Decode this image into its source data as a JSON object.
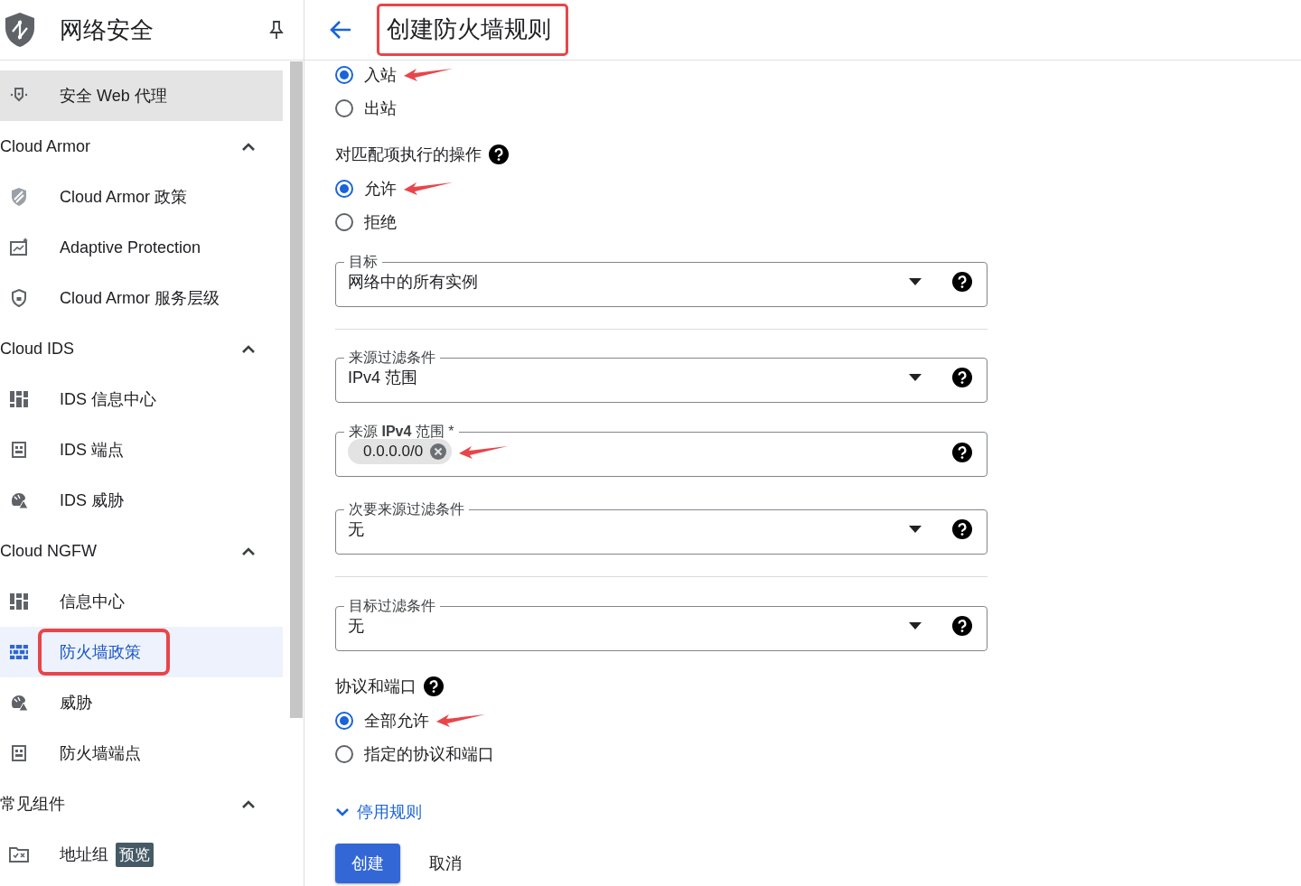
{
  "app": {
    "title": "网络安全"
  },
  "sidebar": {
    "items": [
      {
        "label": "安全 Web 代理",
        "selected": false,
        "hovered": true
      }
    ],
    "sections": [
      {
        "title": "Cloud Armor",
        "expanded": true,
        "items": [
          {
            "label": "Cloud Armor 政策",
            "selected": false,
            "annotated": false
          },
          {
            "label": "Adaptive Protection",
            "selected": false,
            "annotated": false
          },
          {
            "label": "Cloud Armor 服务层级",
            "selected": false,
            "annotated": false
          }
        ]
      },
      {
        "title": "Cloud IDS",
        "expanded": true,
        "items": [
          {
            "label": "IDS 信息中心",
            "selected": false,
            "annotated": false
          },
          {
            "label": "IDS 端点",
            "selected": false,
            "annotated": false
          },
          {
            "label": "IDS 威胁",
            "selected": false,
            "annotated": false
          }
        ]
      },
      {
        "title": "Cloud NGFW",
        "expanded": true,
        "items": [
          {
            "label": "信息中心",
            "selected": false,
            "annotated": false
          },
          {
            "label": "防火墙政策",
            "selected": true,
            "annotated": true
          },
          {
            "label": "威胁",
            "selected": false,
            "annotated": false
          },
          {
            "label": "防火墙端点",
            "selected": false,
            "annotated": false
          }
        ]
      },
      {
        "title": "常见组件",
        "expanded": true,
        "items": [
          {
            "label": "地址组",
            "badge": "预览",
            "selected": false,
            "annotated": false
          }
        ]
      }
    ]
  },
  "page": {
    "title": "创建防火墙规则",
    "annotated": true
  },
  "form": {
    "blocks": [
      {
        "kind": "radio",
        "options": [
          {
            "label": "入站",
            "selected": true,
            "arrow": true
          },
          {
            "label": "出站",
            "selected": false
          }
        ]
      },
      {
        "kind": "radio",
        "label": "对匹配项执行的操作",
        "help": true,
        "options": [
          {
            "label": "允许",
            "selected": true,
            "arrow": true
          },
          {
            "label": "拒绝",
            "selected": false
          }
        ]
      },
      {
        "kind": "select",
        "label": "目标",
        "value": "网络中的所有实例",
        "help": true
      },
      {
        "kind": "divider"
      },
      {
        "kind": "select",
        "label": "来源过滤条件",
        "value": "IPv4 范围",
        "help": true
      },
      {
        "kind": "chips",
        "label": "来源 **IPv4** 范围 *",
        "chips": [
          {
            "label": "0.0.0.0/0",
            "arrow": true
          }
        ],
        "help": true
      },
      {
        "kind": "select",
        "label": "次要来源过滤条件",
        "value": "无",
        "help": true
      },
      {
        "kind": "divider"
      },
      {
        "kind": "select",
        "label": "目标过滤条件",
        "value": "无",
        "help": true
      },
      {
        "kind": "radio",
        "label": "协议和端口",
        "help": true,
        "options": [
          {
            "label": "全部允许",
            "selected": true,
            "arrow": true
          },
          {
            "label": "指定的协议和端口",
            "selected": false
          }
        ]
      }
    ],
    "toggle": {
      "label": "停用规则",
      "expanded": false
    },
    "buttons": [
      {
        "label": "创建",
        "kind": "primary"
      },
      {
        "label": "取消",
        "kind": "text"
      }
    ]
  }
}
